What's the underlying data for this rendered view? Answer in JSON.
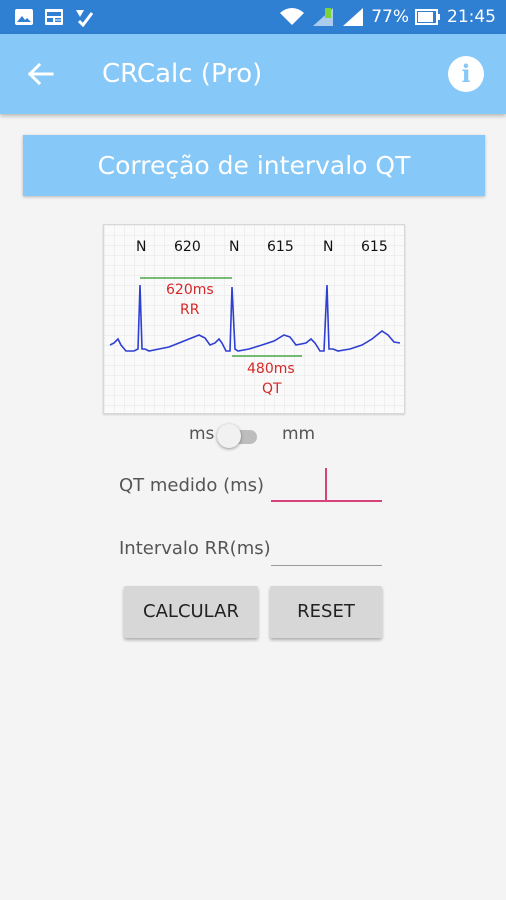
{
  "status": {
    "battery": "77%",
    "time": "21:45"
  },
  "appbar": {
    "title": "CRCalc (Pro)"
  },
  "banner": {
    "title": "Correção de intervalo QT"
  },
  "ecg": {
    "beats": [
      "N",
      "620",
      "N",
      "615",
      "N",
      "615"
    ],
    "rr_value": "620ms",
    "rr_label": "RR",
    "qt_value": "480ms",
    "qt_label": "QT"
  },
  "unit_toggle": {
    "left": "ms",
    "right": "mm",
    "selected": "ms"
  },
  "form": {
    "qt_label": "QT medido (ms)",
    "qt_value": "",
    "rr_label": "Intervalo RR(ms)",
    "rr_value": ""
  },
  "buttons": {
    "calc": "CALCULAR",
    "reset": "RESET"
  },
  "colors": {
    "statusbar": "#2f7fd3",
    "appbar": "#86c8f7",
    "accent": "#d6437a",
    "ecg_trace": "#2e3fd3",
    "annotation": "#d62828"
  }
}
